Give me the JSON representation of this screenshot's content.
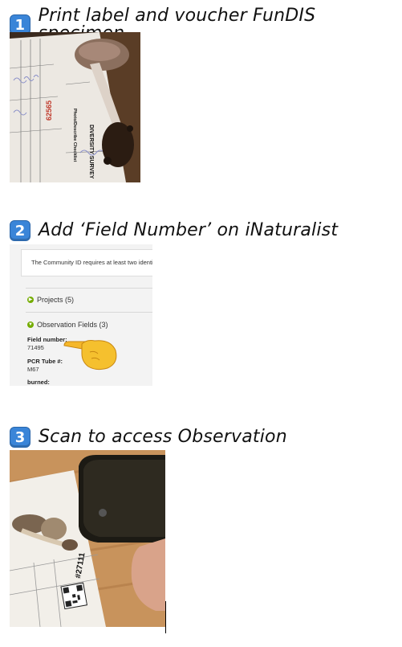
{
  "steps": [
    {
      "number": "1",
      "title": "Print label and voucher FunDIS specimen"
    },
    {
      "number": "2",
      "title": "Add ‘Field Number’ on iNaturalist"
    },
    {
      "number": "3",
      "title": "Scan to access Observation"
    }
  ],
  "step1_image": {
    "label_number": "62565",
    "label_header": "DIVERSITY SURVEY",
    "checklist_title": "Photo/Describe Checklist"
  },
  "inaturalist": {
    "banner_text": "The Community ID requires at least two identific",
    "projects_label": "Projects (5)",
    "observation_fields_label": "Observation Fields (3)",
    "fields": [
      {
        "name": "Field number:",
        "value": "71495"
      },
      {
        "name": "PCR Tube #:",
        "value": "M67"
      },
      {
        "name": "burned:",
        "value": ""
      }
    ],
    "pointing_hand_icon": "backhand-index-pointing-right"
  },
  "step3_image": {
    "label_number": "#27111"
  },
  "colors": {
    "badge": "#3a85d8",
    "inat_green": "#74ac00"
  }
}
